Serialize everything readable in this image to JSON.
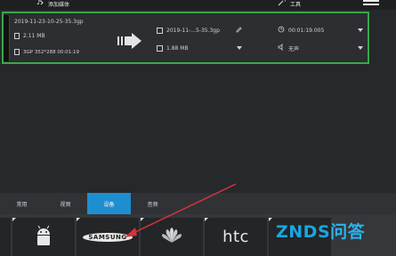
{
  "toolbar": {
    "add_label": "添加媒体",
    "tools_label": "工具"
  },
  "file": {
    "source_name": "2019-11-23-10-25-35.3gp",
    "source_size": "2.11 MB",
    "source_info": "3GP 352*288 00:01:19",
    "output_name": "2019-11-...5-35.3gp",
    "output_size": "1.88 MB",
    "duration": "00:01:19.005",
    "audio": "无声"
  },
  "tabs": [
    {
      "label": "常用"
    },
    {
      "label": "视频"
    },
    {
      "label": "设备"
    },
    {
      "label": "音频"
    }
  ],
  "brands": [
    {
      "name": "android-icon"
    },
    {
      "name": "SAMSUNG"
    },
    {
      "name": "huawei-icon"
    },
    {
      "name": "htc"
    }
  ],
  "watermark": {
    "text_a": "ZNDS",
    "text_b": "问答"
  },
  "colors": {
    "active_tab": "#1d8fd1",
    "selected_border": "#39a84a",
    "annotation": "#d3343a"
  }
}
